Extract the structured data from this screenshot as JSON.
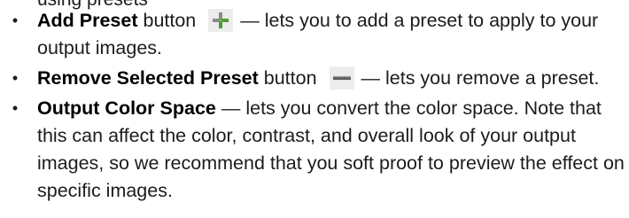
{
  "cut_line_text": "using presets",
  "items": [
    {
      "bullet": "•",
      "term": "Add Preset",
      "after_term": " button",
      "icon": "add-preset-icon",
      "description": "— lets you to add a preset to apply to your output images."
    },
    {
      "bullet": "•",
      "term": "Remove Selected Preset",
      "after_term": " button",
      "icon": "remove-preset-icon",
      "description": "— lets you remove a preset."
    },
    {
      "bullet": "•",
      "term": "Output Color Space",
      "after_term": "",
      "description": "— lets you convert the color space. Note that this can affect the color, contrast, and overall look of your output images, so we recommend that you soft proof to preview the effect on specific images."
    }
  ],
  "colors": {
    "text": "#1c1c1c",
    "icon_green": "#4e9a36",
    "icon_gray": "#8a8a8a"
  }
}
